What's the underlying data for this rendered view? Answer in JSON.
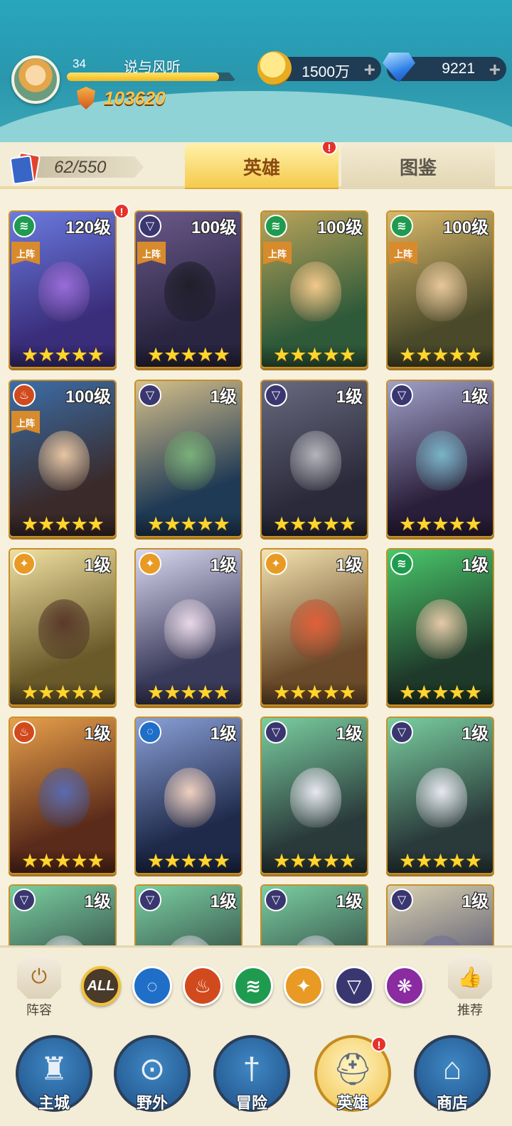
{
  "player": {
    "level": "34",
    "name": "说与风听",
    "xp_progress": 0.9,
    "power": "103620"
  },
  "currencies": {
    "gold": "1500万",
    "gems": "9221"
  },
  "collection": {
    "count": "62/550"
  },
  "tabs": {
    "heroes": "英雄",
    "codex": "图鉴"
  },
  "deploy_label": "上阵",
  "heroes": [
    {
      "level": "120级",
      "element": "wind",
      "deployed": true,
      "stars": "★★★★★",
      "badge": "!",
      "c1": "#3a2d7a",
      "c2": "#6a7be0",
      "face": "#9a6bd8"
    },
    {
      "level": "100级",
      "element": "shadow",
      "deployed": true,
      "stars": "★★★★★",
      "c1": "#2a2540",
      "c2": "#6b5a8c",
      "face": "#1f1f2a"
    },
    {
      "level": "100级",
      "element": "wind",
      "deployed": true,
      "stars": "★★★★★",
      "c1": "#2f5a3a",
      "c2": "#b9a35a",
      "face": "#f2c98a"
    },
    {
      "level": "100级",
      "element": "wind",
      "deployed": true,
      "stars": "★★★★★",
      "c1": "#4a4a2a",
      "c2": "#d8b86a",
      "face": "#e7c79a"
    },
    {
      "level": "100级",
      "element": "fire",
      "deployed": true,
      "stars": "★★★★★",
      "c1": "#3a2a2a",
      "c2": "#3b6ea8",
      "face": "#e8c6a2"
    },
    {
      "level": "1级",
      "element": "shadow",
      "deployed": false,
      "stars": "★★★★★",
      "c1": "#1f3a55",
      "c2": "#d6c08a",
      "face": "#7ab07a"
    },
    {
      "level": "1级",
      "element": "shadow",
      "deployed": false,
      "stars": "★★★★★",
      "c1": "#2a2a3a",
      "c2": "#6a6a80",
      "face": "#b4b4bc"
    },
    {
      "level": "1级",
      "element": "shadow",
      "deployed": false,
      "stars": "★★★★★",
      "c1": "#2a1f3a",
      "c2": "#a0a0c8",
      "face": "#7ab4c8"
    },
    {
      "level": "1级",
      "element": "light",
      "deployed": false,
      "stars": "★★★★★",
      "c1": "#6a5a2a",
      "c2": "#f0e0a0",
      "face": "#5a3a2a"
    },
    {
      "level": "1级",
      "element": "light",
      "deployed": false,
      "stars": "★★★★★",
      "c1": "#3a3a5a",
      "c2": "#d8d8f0",
      "face": "#e8d8e8"
    },
    {
      "level": "1级",
      "element": "light",
      "deployed": false,
      "stars": "★★★★★",
      "c1": "#6a4a2a",
      "c2": "#f4e4b0",
      "face": "#e0603a"
    },
    {
      "level": "1级",
      "element": "wind",
      "deployed": false,
      "stars": "★★★★★",
      "c1": "#1f3a2a",
      "c2": "#4ac86a",
      "face": "#e6c8a8"
    },
    {
      "level": "1级",
      "element": "fire",
      "deployed": false,
      "stars": "★★★★★",
      "c1": "#5a2a1a",
      "c2": "#e8a04a",
      "face": "#5a6ab0"
    },
    {
      "level": "1级",
      "element": "water",
      "deployed": false,
      "stars": "★★★★★",
      "c1": "#1f2a4a",
      "c2": "#8aa0d8",
      "face": "#f0d0c0"
    },
    {
      "level": "1级",
      "element": "shadow",
      "deployed": false,
      "stars": "★★★★★",
      "c1": "#2a3a3a",
      "c2": "#7acfa0",
      "face": "#e8e8f0"
    },
    {
      "level": "1级",
      "element": "shadow",
      "deployed": false,
      "stars": "★★★★★",
      "c1": "#2a3a3a",
      "c2": "#7acfa0",
      "face": "#e8e8f0"
    },
    {
      "level": "1级",
      "element": "shadow",
      "deployed": false,
      "stars": "★★★★★",
      "c1": "#2a3a3a",
      "c2": "#7acfa0",
      "face": "#e8e8f0"
    },
    {
      "level": "1级",
      "element": "shadow",
      "deployed": false,
      "stars": "★★★★★",
      "c1": "#2a3a3a",
      "c2": "#7acfa0",
      "face": "#e8e8f0"
    },
    {
      "level": "1级",
      "element": "shadow",
      "deployed": false,
      "stars": "★★★★★",
      "c1": "#2a3a3a",
      "c2": "#7acfa0",
      "face": "#e8e8f0"
    },
    {
      "level": "1级",
      "element": "shadow",
      "deployed": false,
      "stars": "★★★★★",
      "c1": "#4a4a6a",
      "c2": "#d8d0b0",
      "face": "#8080a8"
    }
  ],
  "element_colors": {
    "wind": "#1f9b4f",
    "shadow": "#3a3670",
    "fire": "#d14a1e",
    "light": "#e89a24",
    "water": "#1f6fc8",
    "chaos": "#8a2ba0"
  },
  "filters": {
    "lineup_label": "阵容",
    "recommend_label": "推荐",
    "all_label": "ALL",
    "elements": [
      "water",
      "fire",
      "wind",
      "light",
      "shadow",
      "chaos"
    ]
  },
  "nav": [
    {
      "label": "主城",
      "icon": "castle-icon"
    },
    {
      "label": "野外",
      "icon": "portal-icon"
    },
    {
      "label": "冒险",
      "icon": "sword-icon"
    },
    {
      "label": "英雄",
      "icon": "helmet-icon",
      "active": true,
      "badge": "!"
    },
    {
      "label": "商店",
      "icon": "shop-icon"
    }
  ]
}
